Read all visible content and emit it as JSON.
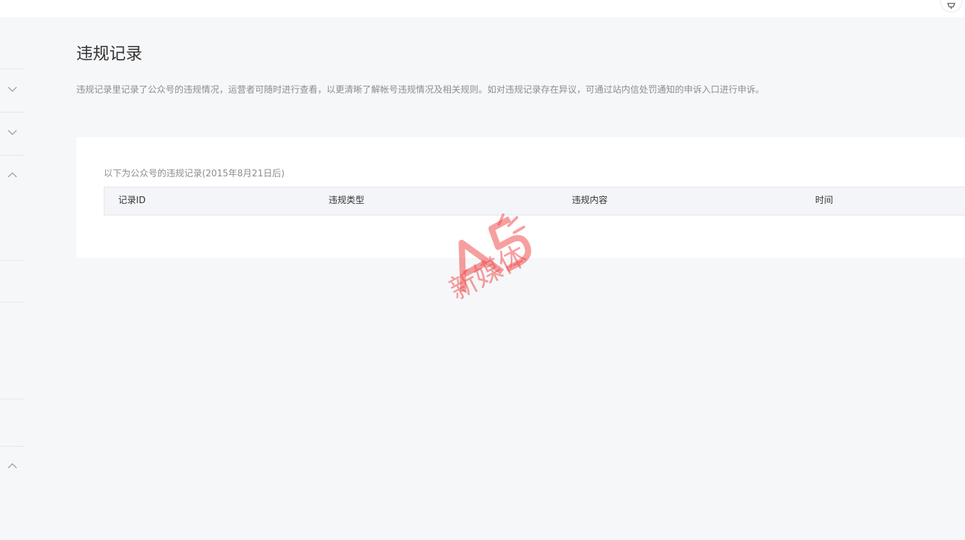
{
  "header": {
    "action_icon": "notification-icon"
  },
  "sidebar": {
    "chevrons": [
      "chevron-down-icon",
      "chevron-down-icon",
      "chevron-up-icon",
      "chevron-up-icon"
    ]
  },
  "main": {
    "title": "违规记录",
    "description": "违规记录里记录了公众号的违规情况，运营者可随时进行查看，以更清晰了解帐号违规情况及相关规则。如对违规记录存在异议，可通过站内信处罚通知的申诉入口进行申诉。",
    "table": {
      "caption": "以下为公众号的违规记录(2015年8月21日后)",
      "columns": [
        "记录ID",
        "违规类型",
        "违规内容",
        "时间"
      ],
      "rows": []
    }
  },
  "watermark": {
    "logo": "A5",
    "text": "新媒体",
    "color": "#f05050"
  },
  "colors": {
    "background": "#f6f7f9",
    "card": "#ffffff",
    "table_header": "#f4f5f9",
    "border": "#e4e6eb",
    "text_primary": "#353535",
    "text_secondary": "#8d8d8d"
  }
}
